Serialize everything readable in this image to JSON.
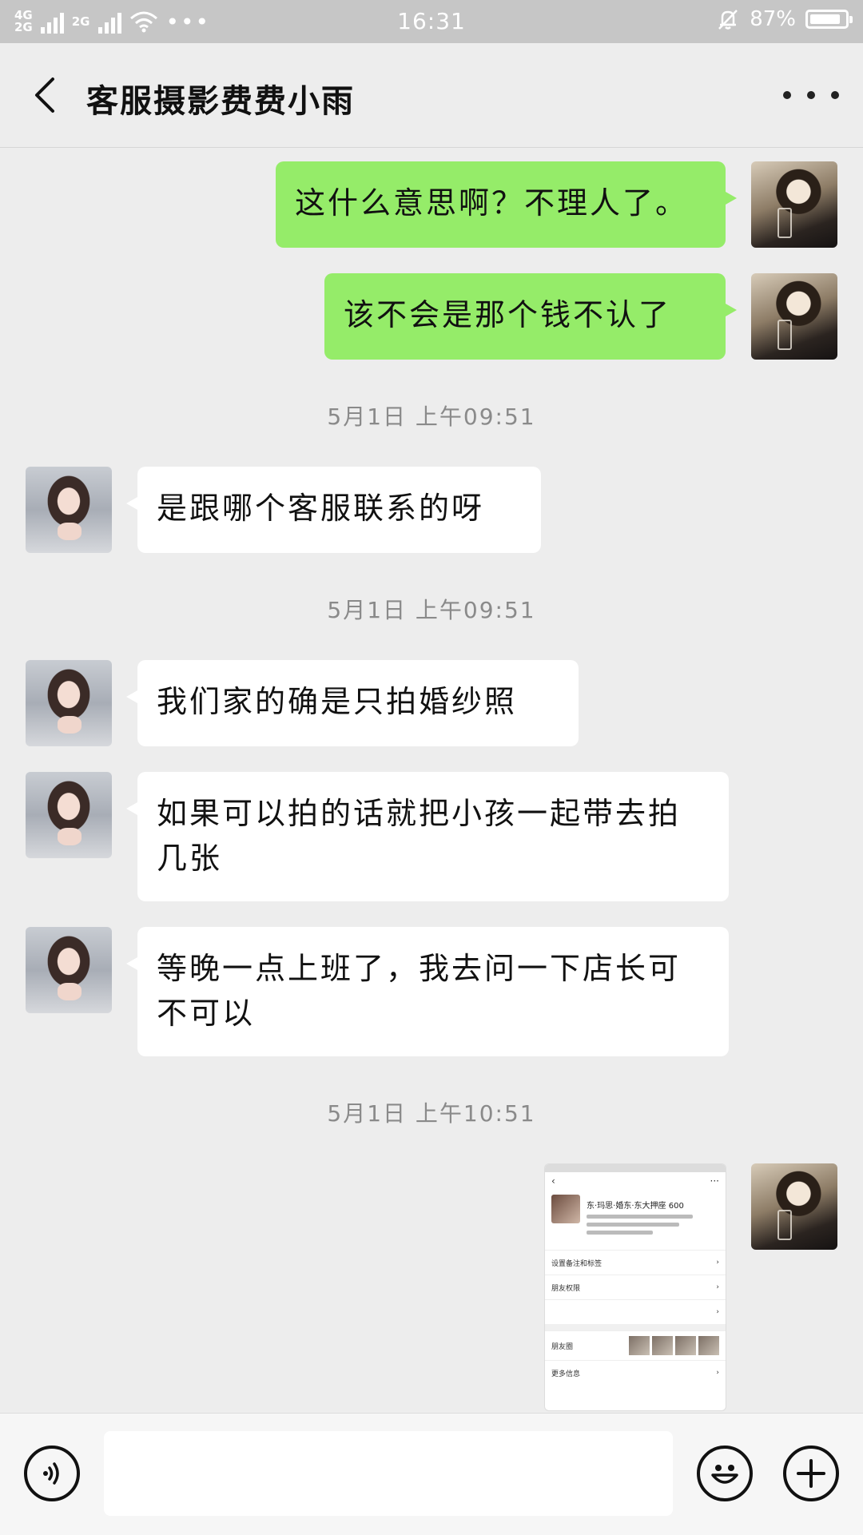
{
  "status_bar": {
    "network_top": "4G",
    "network_bottom": "2G",
    "network_second": "2G",
    "time": "16:31",
    "battery": "87%",
    "battery_level": 0.87
  },
  "header": {
    "title": "客服摄影费费小雨"
  },
  "messages": [
    {
      "side": "me",
      "text": "这什么意思啊？不理人了。"
    },
    {
      "side": "me",
      "text": "该不会是那个钱不认了"
    },
    {
      "side": "time",
      "text": "5月1日 上午09:51"
    },
    {
      "side": "her",
      "text": "是跟哪个客服联系的呀"
    },
    {
      "side": "time",
      "text": "5月1日 上午09:51"
    },
    {
      "side": "her",
      "text": "我们家的确是只拍婚纱照"
    },
    {
      "side": "her",
      "text": "如果可以拍的话就把小孩一起带去拍几张"
    },
    {
      "side": "her",
      "text": "等晚一点上班了，我去问一下店长可不可以"
    },
    {
      "side": "time",
      "text": "5月1日 上午10:51"
    },
    {
      "side": "me",
      "type": "image",
      "caption_name": "东·玛思·婚东·东大押座 600",
      "row1": "设置备注和标签",
      "row2": "朋友权限",
      "row3": "朋友圈",
      "row4": "更多信息"
    }
  ],
  "input_bar": {
    "placeholder": ""
  },
  "icons": {
    "back": "back-chevron-icon",
    "more": "more-dots-icon",
    "voice": "voice-icon",
    "emoji": "emoji-icon",
    "plus": "plus-icon"
  },
  "colors": {
    "my_bubble": "#95ec69",
    "her_bubble": "#ffffff",
    "background": "#ededed"
  }
}
